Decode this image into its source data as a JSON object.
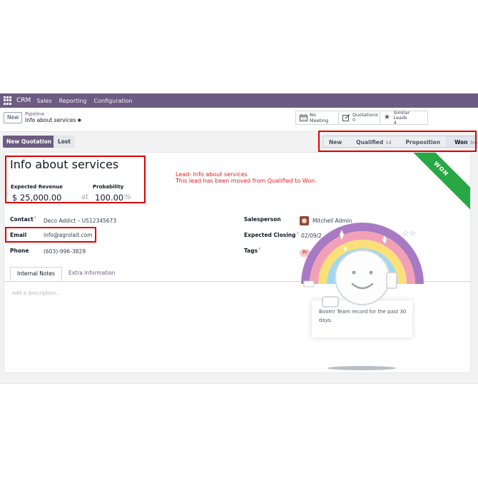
{
  "navbar": {
    "brand": "CRM",
    "items": [
      "Sales",
      "Reporting",
      "Configuration"
    ]
  },
  "control": {
    "new_label": "New",
    "breadcrumb_parent": "Pipeline",
    "breadcrumb_current": "Info about services",
    "smart_buttons": {
      "meeting": "No Meeting",
      "quotations_label": "Quotations",
      "quotations_count": "0",
      "similar_label": "Similar Leads",
      "similar_count": "4"
    }
  },
  "actions": {
    "new_quotation": "New Quotation",
    "lost": "Lost"
  },
  "stages": [
    {
      "label": "New",
      "duration": ""
    },
    {
      "label": "Qualified",
      "duration": "1d"
    },
    {
      "label": "Proposition",
      "duration": ""
    },
    {
      "label": "Won",
      "duration": "3m"
    }
  ],
  "ribbon": "WON",
  "lead": {
    "title": "Info about services",
    "expected_revenue_label": "Expected Revenue",
    "probability_label": "Probability",
    "expected_revenue": "$ 25,000.00",
    "at": "at",
    "probability": "100.00",
    "percent": "%"
  },
  "annotation": {
    "line1": "Lead- Info about services",
    "line2": "This lead has been moved from Qualified to Won."
  },
  "fields": {
    "contact_label": "Contact",
    "contact_value": "Deco Addict – US12345673",
    "email_label": "Email",
    "email_value": "info@agrolait.com",
    "phone_label": "Phone",
    "phone_value": "(603)-996-3829",
    "salesperson_label": "Salesperson",
    "salesperson_value": "Mitchell Admin",
    "expected_closing_label": "Expected Closing",
    "expected_closing_value": "02/09/2",
    "tags_label": "Tags",
    "tag_value": "Pr"
  },
  "tabs": [
    "Internal Notes",
    "Extra Information"
  ],
  "description_placeholder": "Add a description...",
  "popup": {
    "message": "Boom! Team record for the past 30 days."
  },
  "colors": {
    "brand": "#6c5b82",
    "won_ribbon": "#28a745",
    "highlight": "#e00000",
    "annotation_text": "#e11d1d"
  }
}
